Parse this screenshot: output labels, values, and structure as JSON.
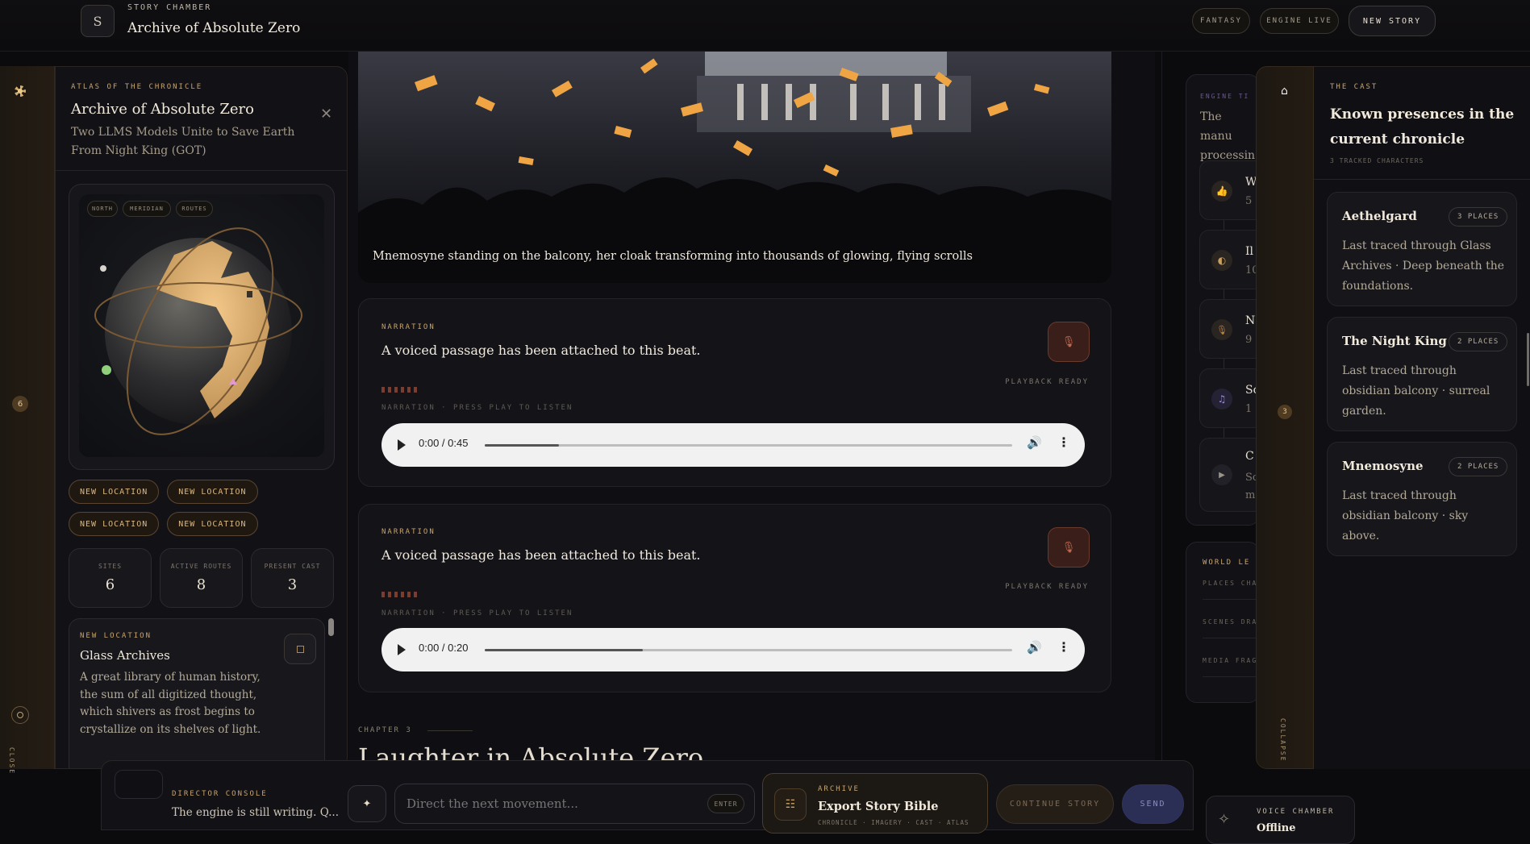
{
  "header": {
    "eyebrow": "STORY CHAMBER",
    "title": "Archive of Absolute Zero",
    "logo_letter": "S",
    "genre_chip": "FANTASY",
    "engine_chip": "ENGINE LIVE",
    "new_story": "NEW STORY"
  },
  "left_rail": {
    "top_icon": "sun-icon",
    "count": "6",
    "close_icon": "target-icon",
    "close_label": "CLOSE"
  },
  "atlas": {
    "eyebrow": "ATLAS OF THE CHRONICLE",
    "title": "Archive of Absolute Zero",
    "subtitle": "Two LLMS Models Unite to Save Earth From Night King (GOT)",
    "globe_tabs": [
      "NORTH",
      "MERIDIAN",
      "ROUTES"
    ],
    "location_buttons": [
      "NEW LOCATION",
      "NEW LOCATION",
      "NEW LOCATION",
      "NEW LOCATION"
    ],
    "stats": [
      {
        "label": "SITES",
        "value": "6"
      },
      {
        "label": "ACTIVE ROUTES",
        "value": "8"
      },
      {
        "label": "PRESENT CAST",
        "value": "3"
      }
    ],
    "location_card": {
      "eyebrow": "NEW LOCATION",
      "title": "Glass Archives",
      "body": "A great library of human history, the sum of all digitized thought, which shivers as frost begins to crystallize on its shelves of light."
    }
  },
  "story": {
    "image_caption": "Mnemosyne standing on the balcony, her cloak transforming into thousands of glowing, flying scrolls",
    "narrations": [
      {
        "eyebrow": "NARRATION",
        "title": "A voiced passage has been attached to this beat.",
        "status": "PLAYBACK READY",
        "hint": "NARRATION · PRESS PLAY TO LISTEN",
        "time": "0:00 / 0:45",
        "progress": 0.14
      },
      {
        "eyebrow": "NARRATION",
        "title": "A voiced passage has been attached to this beat.",
        "status": "PLAYBACK READY",
        "hint": "NARRATION · PRESS PLAY TO LISTEN",
        "time": "0:00 / 0:20",
        "progress": 0.3
      }
    ],
    "chapter_label": "CHAPTER 3",
    "chapter_title": "Laughter in Absolute Zero"
  },
  "engine_panel": {
    "eyebrow": "ENGINE TI",
    "text": "The manu processin",
    "items": [
      {
        "icon": "thumbs-up-icon",
        "title": "W",
        "sub": "5",
        "color": "#d9a441"
      },
      {
        "icon": "half-moon-icon",
        "title": "Il",
        "sub": "10",
        "color": "#caa060"
      },
      {
        "icon": "microphone-icon",
        "title": "N",
        "sub": "9",
        "color": "#b7824c"
      },
      {
        "icon": "music-note-icon",
        "title": "Sc",
        "sub": "1",
        "color": "#9c89d8"
      },
      {
        "icon": "play-icon",
        "title": "C",
        "sub": "Sc m",
        "color": "#9a9387"
      }
    ]
  },
  "world_panel": {
    "eyebrow": "WORLD LE",
    "rows": [
      "PLACES CHA",
      "SCENES DRA",
      "MEDIA FRAG"
    ]
  },
  "cast": {
    "rail_icon": "home-icon",
    "count": "3",
    "collapse": "COLLAPSE",
    "eyebrow": "THE CAST",
    "title": "Known presences in the current chronicle",
    "tracked": "3 TRACKED CHARACTERS",
    "characters": [
      {
        "name": "Aethelgard",
        "badge": "3 PLACES",
        "desc": "Last traced through Glass Archives · Deep beneath the foundations."
      },
      {
        "name": "The Night King",
        "badge": "2 PLACES",
        "desc": "Last traced through obsidian balcony · surreal garden."
      },
      {
        "name": "Mnemosyne",
        "badge": "2 PLACES",
        "desc": "Last traced through obsidian balcony · sky above."
      }
    ]
  },
  "console": {
    "eyebrow": "DIRECTOR CONSOLE",
    "status": "The engine is still writing. Q...",
    "placeholder": "Direct the next movement...",
    "enter": "ENTER",
    "archive_eyebrow": "ARCHIVE",
    "archive_title": "Export Story Bible",
    "archive_sub": "CHRONICLE · IMAGERY · CAST · ATLAS",
    "continue": "CONTINUE STORY",
    "send": "SEND"
  },
  "voice": {
    "eyebrow": "VOICE CHAMBER",
    "status": "Offline"
  },
  "colors": {
    "accent_gold": "#c9a46a",
    "send_blue": "#2b2f55",
    "background": "#0b0a0d"
  }
}
